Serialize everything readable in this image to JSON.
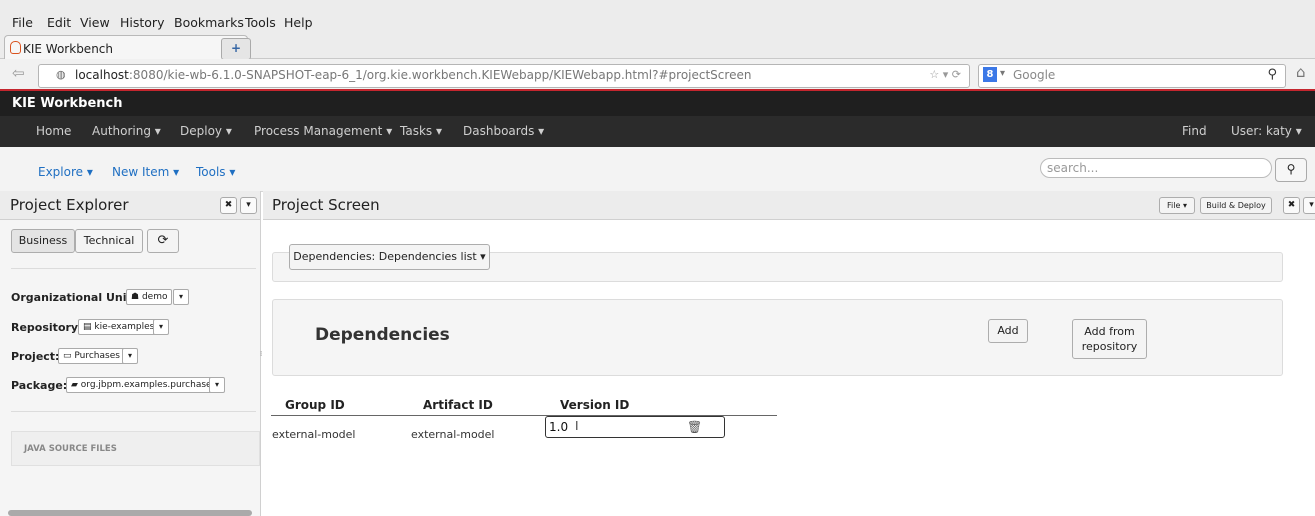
{
  "browser": {
    "menu": [
      "File",
      "Edit",
      "View",
      "History",
      "Bookmarks",
      "Tools",
      "Help"
    ],
    "tab_title": "KIE Workbench",
    "newtab_icon": "+",
    "url_host": "localhost",
    "url_rest": ":8080/kie-wb-6.1.0-SNAPSHOT-eap-6_1/org.kie.workbench.KIEWebapp/KIEWebapp.html?#projectScreen",
    "search_engine": "Google"
  },
  "app": {
    "brand": "KIE Workbench",
    "nav": [
      "Home",
      "Authoring ▾",
      "Deploy ▾",
      "Process Management ▾",
      "Tasks ▾",
      "Dashboards ▾"
    ],
    "find": "Find",
    "user": "User: katy ▾",
    "toolbar": [
      "Explore ▾",
      "New Item ▾",
      "Tools ▾"
    ],
    "search_placeholder": "search..."
  },
  "left": {
    "title": "Project Explorer",
    "tabs": [
      "Business",
      "Technical"
    ],
    "refresh_icon": "⟳",
    "org_unit_label": "Organizational Unit:",
    "org_unit_value": "demo",
    "repository_label": "Repository:",
    "repository_value": "kie-examples",
    "project_label": "Project:",
    "project_value": "Purchases",
    "package_label": "Package:",
    "package_value": "org.jbpm.examples.purchases",
    "section": "JAVA SOURCE FILES"
  },
  "right": {
    "title": "Project Screen",
    "file_btn": "File ▾",
    "build_btn": "Build & Deploy",
    "dependencies_dropdown": "Dependencies: Dependencies list ▾",
    "heading": "Dependencies",
    "add_btn": "Add",
    "add_repo_line1": "Add from",
    "add_repo_line2": "repository",
    "columns": [
      "Group ID",
      "Artifact ID",
      "Version ID"
    ],
    "rows": [
      {
        "group": "external-model",
        "artifact": "external-model",
        "version": "1.0"
      }
    ]
  },
  "colors": {
    "accent_red": "#c4262e",
    "link_blue": "#1f6fc2",
    "dark_nav": "#2b2b2b"
  }
}
